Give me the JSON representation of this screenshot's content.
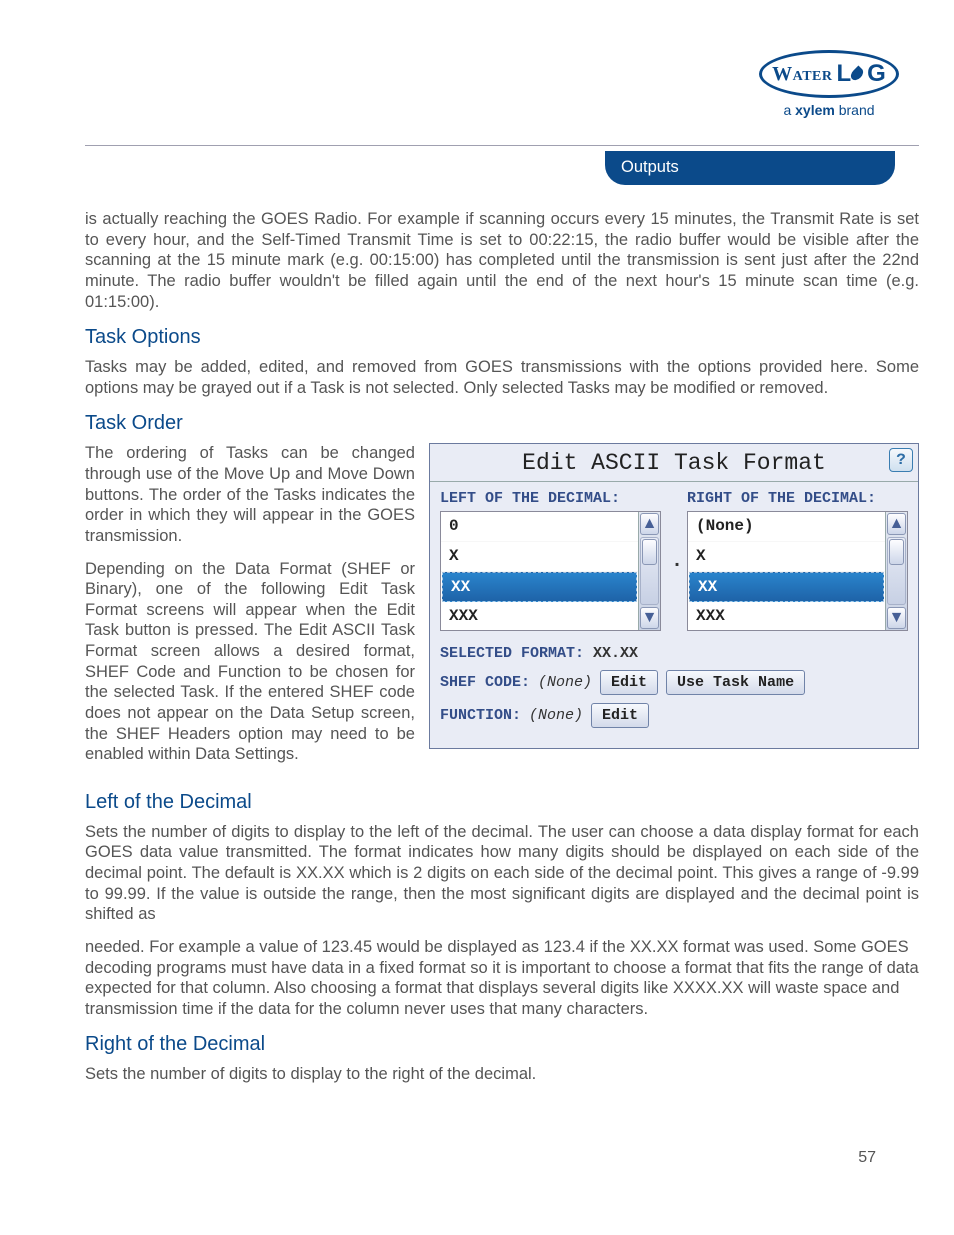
{
  "logo": {
    "word1": "Water",
    "word2": "L",
    "word3": "G",
    "tagline_a": "a ",
    "tagline_b": "xylem",
    "tagline_c": " brand"
  },
  "tab_title": "Outputs",
  "para_intro": "is actually reaching the GOES Radio. For example if scanning occurs every 15 minutes, the Transmit Rate is set to every hour, and the Self-Timed Transmit Time is set to 00:22:15, the radio buffer would be visible after the scanning at the 15 minute mark (e.g. 00:15:00) has completed until the transmission is sent just after the 22nd minute. The radio buffer wouldn't be filled again until the end of the next hour's 15 minute scan time (e.g. 01:15:00).",
  "headings": {
    "task_options": "Task Options",
    "task_order": "Task Order",
    "left_dec": "Left of the Decimal",
    "right_dec": "Right of the Decimal"
  },
  "para_task_options": "Tasks may be added, edited, and removed from GOES transmissions with the options provided here. Some options may be grayed out if a Task is not selected. Only selected Tasks may be modified or removed.",
  "para_task_order_1": "The ordering of Tasks can be changed through use of the Move Up and Move Down buttons. The order of the Tasks indicates the order in which they will appear in the GOES transmission.",
  "para_task_order_2": "Depending on the Data Format (SHEF or Binary), one of the following Edit Task Format screens will appear when the Edit Task button is pressed. The Edit ASCII Task Format screen allows a desired format, SHEF Code and Function to be chosen for the selected Task. If the entered SHEF code does not appear on the Data Setup screen, the SHEF Headers option may need to be enabled within Data Settings.",
  "para_left_dec": "Sets the number of digits to display to the left of the decimal. The user can choose a data display format for each GOES data value transmitted. The format indicates how many digits should be displayed on each side of the decimal point. The default is XX.XX which is 2 digits on each side of the decimal point. This gives a range of -9.99 to 99.99. If the value is outside the range, then the most significant digits are displayed and the decimal point is shifted as",
  "para_left_dec_2": "needed. For example a value of 123.45 would be displayed as 123.4 if the XX.XX format was used. Some GOES decoding programs must have data in a fixed format so it is important to choose a format that fits the range of data expected for that column. Also choosing a format that displays several digits like XXXX.XX will waste space and transmission time if the data for the column never uses that many characters.",
  "para_right_dec": "Sets the number of digits to display to the right of the decimal.",
  "page_number": "57",
  "panel": {
    "title": "Edit ASCII Task Format",
    "help": "?",
    "left_label": "LEFT OF THE DECIMAL:",
    "right_label": "RIGHT OF THE DECIMAL:",
    "left_opts": [
      "0",
      "X",
      "XX",
      "XXX"
    ],
    "right_opts": [
      "(None)",
      "X",
      "XX",
      "XXX"
    ],
    "dot": ".",
    "selected_label": "SELECTED FORMAT:",
    "selected_value": "XX.XX",
    "shef_label": "SHEF CODE:",
    "shef_value": "(None)",
    "edit_btn": "Edit",
    "use_task": "Use Task Name",
    "func_label": "FUNCTION:",
    "func_value": "(None)"
  }
}
